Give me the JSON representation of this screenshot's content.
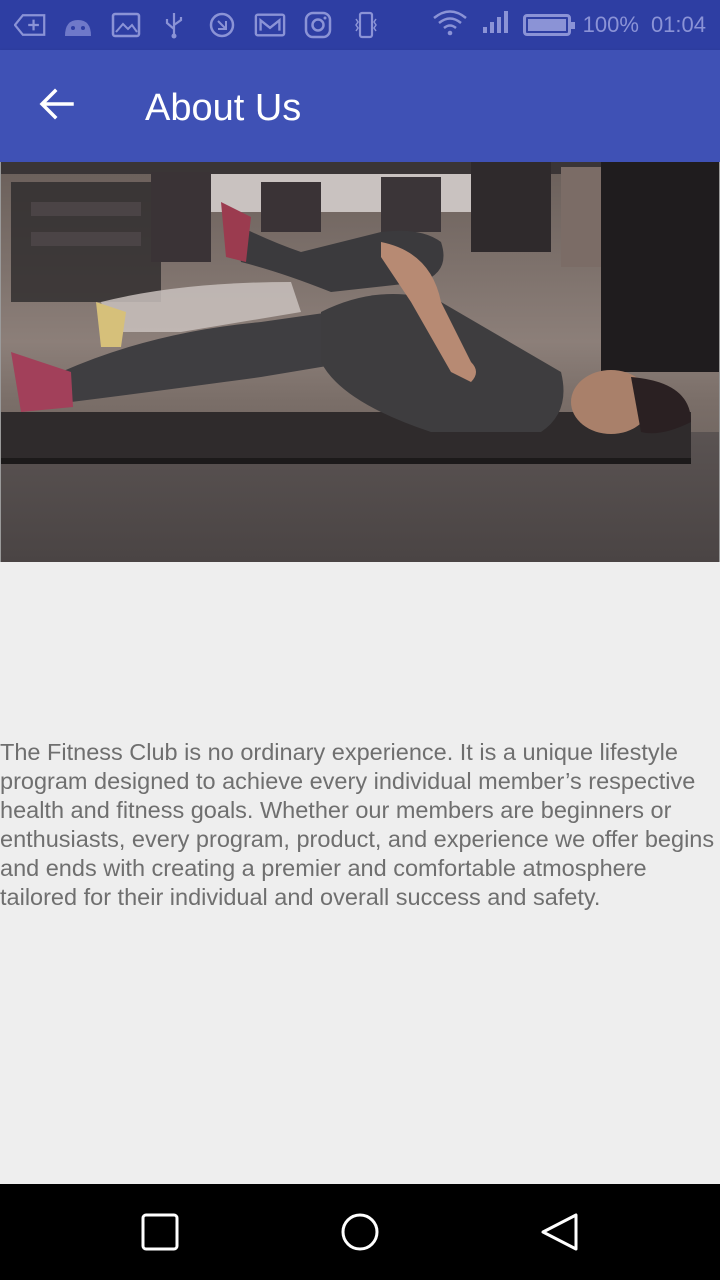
{
  "status_bar": {
    "battery_percent": "100%",
    "time": "01:04",
    "icons": [
      "add-tab-icon",
      "android-icon",
      "image-icon",
      "usb-icon",
      "sync-icon",
      "mail-icon",
      "instagram-icon",
      "vibrate-icon",
      "wifi-icon",
      "signal-icon",
      "battery-icon"
    ]
  },
  "app_bar": {
    "title": "About Us",
    "background": "#3f51b5",
    "back_icon": "arrow-back-icon"
  },
  "hero_image": {
    "description_icon": "gym-photo"
  },
  "content": {
    "about_text": "The Fitness Club is no ordinary experience. It is a unique lifestyle program designed to achieve every individual member’s respective health and fitness goals. Whether our members are beginners or enthusiasts, every program, product, and experience we offer begins and ends with creating a premier and comfortable atmosphere tailored for their individual and overall success and safety."
  },
  "nav_bar": {
    "icons": [
      "recents-icon",
      "home-icon",
      "back-icon"
    ]
  }
}
